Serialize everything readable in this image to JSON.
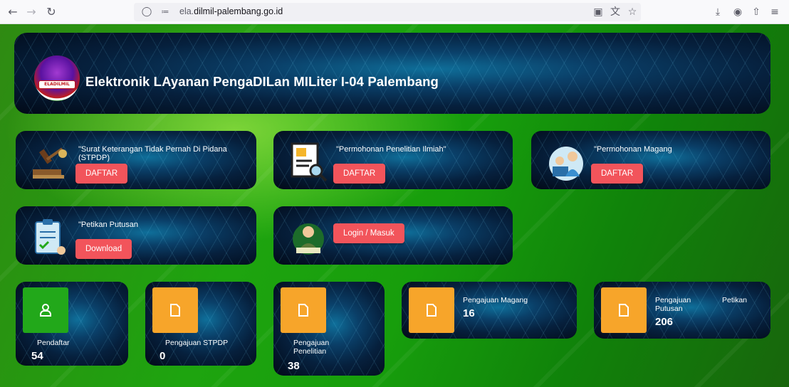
{
  "browser": {
    "url_prefix": "ela.",
    "url_domain": "dilmil-palembang.go.id"
  },
  "header": {
    "logo_text": "ELADILMIL",
    "title": "Elektronik LAyanan PengaDILan MILiter I-04 Palembang"
  },
  "services": [
    {
      "title": "\"Surat Keterangan Tidak Pernah Di Pidana (STPDP)",
      "button": "DAFTAR",
      "icon": "gavel-icon"
    },
    {
      "title": "\"Permohonan Penelitian Ilmiah\"",
      "button": "DAFTAR",
      "icon": "document-search-icon"
    },
    {
      "title": "\"Permohonan Magang",
      "button": "DAFTAR",
      "icon": "intern-icon"
    },
    {
      "title": "\"Petikan Putusan",
      "button": "Download",
      "icon": "clipboard-icon"
    },
    {
      "title": "",
      "button": "Login / Masuk",
      "icon": "officer-icon"
    }
  ],
  "stats": [
    {
      "label": "Pendaftar",
      "value": "54",
      "icon": "user-icon",
      "color": "#22a81a"
    },
    {
      "label": "Pengajuan STPDP",
      "value": "0",
      "icon": "file-icon",
      "color": "#f7a52a"
    },
    {
      "label": "Pengajuan\nPenelitian",
      "value": "38",
      "icon": "file-icon",
      "color": "#f7a52a"
    },
    {
      "label": "Pengajuan Magang",
      "value": "16",
      "icon": "file-icon",
      "color": "#f7a52a"
    },
    {
      "label": "Pengajuan\nPutusan",
      "label2": "Petikan",
      "value": "206",
      "icon": "file-icon",
      "color": "#f7a52a"
    }
  ]
}
